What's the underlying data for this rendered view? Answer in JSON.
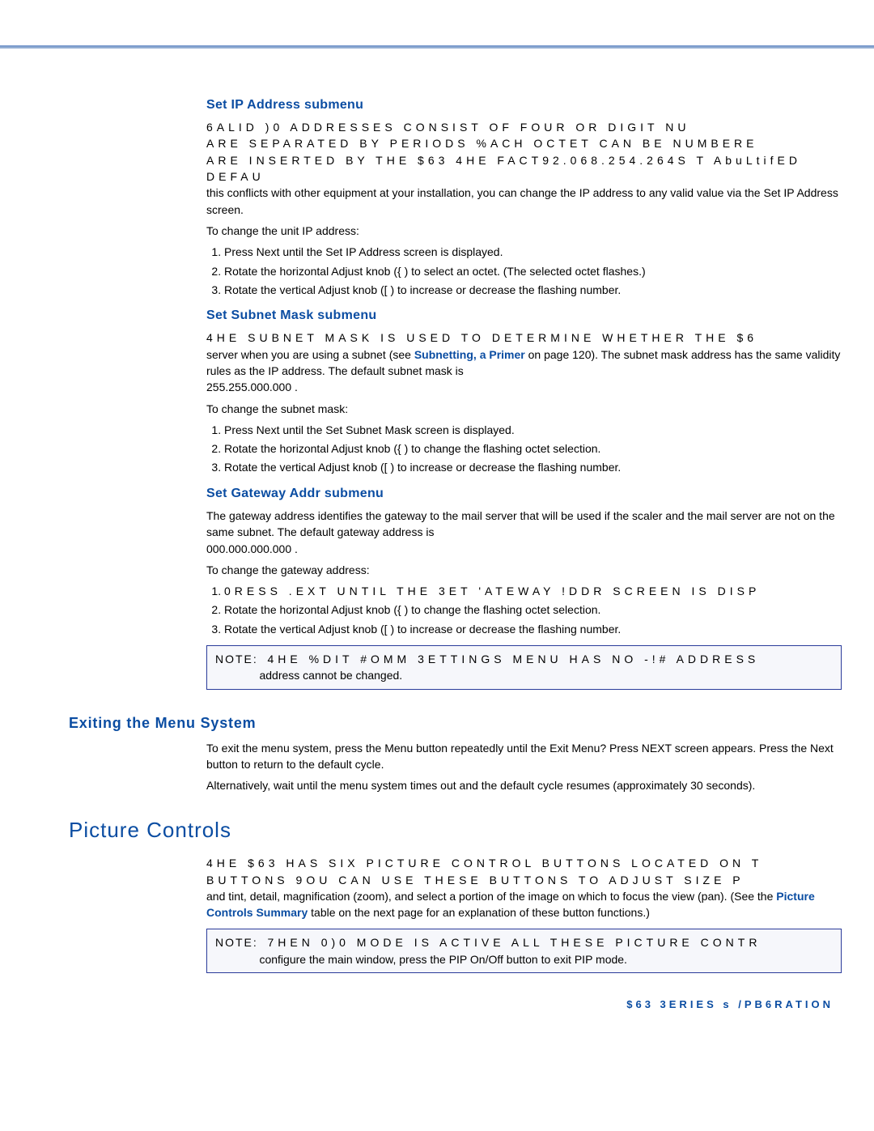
{
  "section_ip": {
    "heading": "Set IP Address submenu",
    "p1_line1": "6ALID )0 ADDRESSES CONSIST OF FOUR     OR   DIGIT NU",
    "p1_line2": "ARE SEPARATED BY PERIODS  %ACH OCTET CAN BE NUMBERE",
    "p1_line3": "ARE INSERTED BY THE $63   4HE FACT92.068.254.264S T AbuLtifED DEFAU",
    "p1_tail": "this conflicts with other equipment at your installation, you can change the IP address to any valid value via the Set IP Address screen.",
    "lead": "To change the unit IP address:",
    "li1": "Press Next until the Set IP Address screen is displayed.",
    "li2": "Rotate the horizontal Adjust knob ({ ) to select an octet. (The selected octet flashes.)",
    "li3": "Rotate the vertical Adjust knob ([   ) to increase or decrease the flashing number."
  },
  "section_subnet": {
    "heading": "Set Subnet Mask submenu",
    "p1_line1": "4HE SUBNET MASK IS USED TO DETERMINE WHETHER THE $6",
    "p1_tail_a": "server when you are using a subnet (see ",
    "link": "Subnetting, a Primer",
    "p1_tail_b": " on page 120). The subnet mask address has the same validity rules as the IP address. The default subnet mask is",
    "default_mask": "255.255.000.000    .",
    "lead": "To change the subnet mask:",
    "li1": "Press Next until the Set Subnet Mask screen is displayed.",
    "li2": "Rotate the horizontal Adjust knob ({ ) to change the flashing octet selection.",
    "li3": "Rotate the vertical Adjust knob ([   ) to increase or decrease the flashing number."
  },
  "section_gateway": {
    "heading": "Set Gateway Addr submenu",
    "p1": "The gateway address identifies the gateway to the mail server that will be used if the scaler and the mail server are not on the same subnet. The default gateway address is",
    "default_gw": "000.000.000.000    .",
    "lead": "To change the gateway address:",
    "li1": "0RESS .EXT UNTIL THE 3ET 'ATEWAY !DDR SCREEN IS DISP",
    "li2": "Rotate the horizontal Adjust knob ({ ) to change the flashing octet selection.",
    "li3": "Rotate the vertical Adjust knob ([   ) to increase or decrease the flashing number.",
    "note_label": "NOTE:",
    "note_line1": "4HE %DIT #OMM 3ETTINGS MENU HAS NO -!# ADDRESS",
    "note_line2": "address cannot be changed."
  },
  "section_exit": {
    "heading": "Exiting the Menu System",
    "p1a": "To exit the menu system, press the Menu button repeatedly until the ",
    "p1b": "Exit   Menu? Press NEXT",
    "p1c": " screen appears. Press the Next button to return to the default cycle.",
    "p2": "Alternatively, wait until the menu system times out and the default cycle resumes (approximately 30 seconds)."
  },
  "section_picture": {
    "heading": "Picture Controls",
    "p1_line1": "4HE $63 HAS SIX PICTURE CONTROL BUTTONS LOCATED ON T",
    "p1_line2": "BUTTONS  9OU CAN USE THESE BUTTONS TO ADJUST SIZE  P",
    "p1_tail_a": "and tint, detail, magnification (zoom), and select a portion of the image on which to focus the view (pan). (See the ",
    "link": "Picture Controls Summary",
    "p1_tail_b": " table on the next page for an explanation of these button functions.)",
    "note_label": "NOTE:",
    "note_line1": "7HEN 0)0 MODE IS ACTIVE  ALL THESE PICTURE  CONTR",
    "note_line2": "configure the main window, press the PIP On/Off button to exit PIP mode."
  },
  "footer": "$63    3ERIES s /PB6RATION"
}
